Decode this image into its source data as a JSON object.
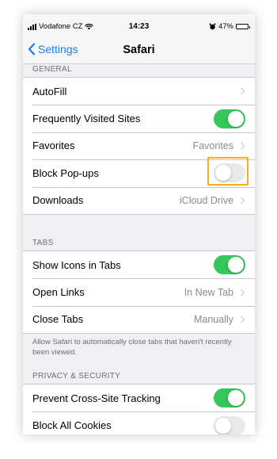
{
  "status_bar": {
    "carrier": "Vodafone CZ",
    "time": "14:23",
    "battery": "47%",
    "battery_level": 0.47
  },
  "nav": {
    "back_label": "Settings",
    "title": "Safari"
  },
  "sections": {
    "general": {
      "header": "GENERAL",
      "autofill": {
        "label": "AutoFill"
      },
      "frequently_visited": {
        "label": "Frequently Visited Sites",
        "on": true
      },
      "favorites": {
        "label": "Favorites",
        "value": "Favorites"
      },
      "block_popups": {
        "label": "Block Pop-ups",
        "on": false
      },
      "downloads": {
        "label": "Downloads",
        "value": "iCloud Drive"
      }
    },
    "tabs": {
      "header": "TABS",
      "show_icons": {
        "label": "Show Icons in Tabs",
        "on": true
      },
      "open_links": {
        "label": "Open Links",
        "value": "In New Tab"
      },
      "close_tabs": {
        "label": "Close Tabs",
        "value": "Manually"
      },
      "footer": "Allow Safari to automatically close tabs that haven't recently been viewed."
    },
    "privacy": {
      "header": "PRIVACY & SECURITY",
      "prevent_tracking": {
        "label": "Prevent Cross-Site Tracking",
        "on": true
      },
      "block_cookies": {
        "label": "Block All Cookies",
        "on": false
      }
    }
  },
  "colors": {
    "accent_blue": "#1a7bf5",
    "toggle_on": "#34c759",
    "highlight": "#f2b01e"
  }
}
